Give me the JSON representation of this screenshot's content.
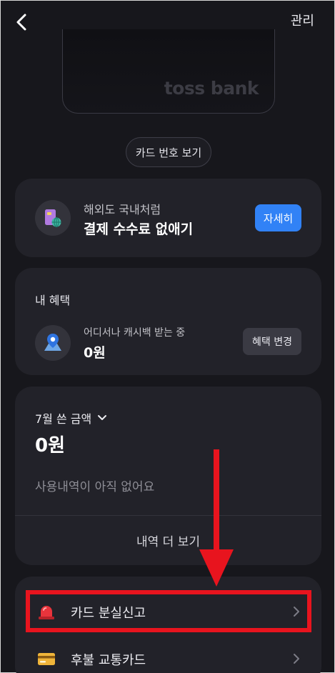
{
  "header": {
    "back_label": "뒤로",
    "manage_label": "관리"
  },
  "card": {
    "brand": "toss bank",
    "number_button": "카드 번호 보기"
  },
  "promo": {
    "line1": "해외도 국내처럼",
    "line2": "결제 수수료 없애기",
    "button": "자세히"
  },
  "benefit": {
    "title": "내 혜택",
    "label": "어디서나 캐시백 받는 중",
    "value": "0원",
    "button": "혜택 변경"
  },
  "spending": {
    "month_label": "7월 쓴 금액",
    "amount": "0원",
    "empty_message": "사용내역이 아직 없어요",
    "more_button": "내역 더 보기"
  },
  "menu": {
    "items": [
      {
        "label": "카드 분실신고",
        "icon": "siren-icon"
      },
      {
        "label": "후불 교통카드",
        "icon": "transit-card-icon"
      }
    ]
  },
  "colors": {
    "background": "#17171c",
    "panel": "#222229",
    "accent": "#3182f6",
    "annotation": "#e8141e"
  }
}
